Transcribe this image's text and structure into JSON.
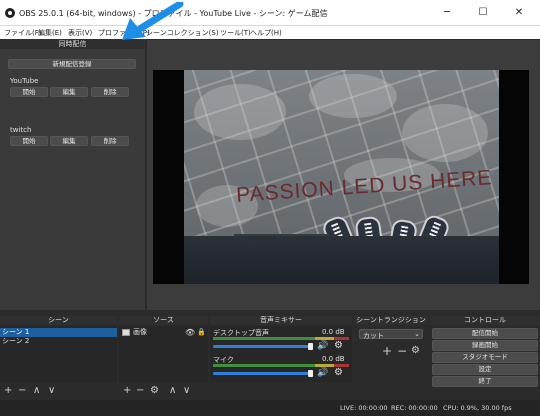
{
  "window": {
    "title": "OBS 25.0.1 (64-bit, windows) - プロファイル - YouTube Live - シーン: ゲーム配信",
    "min_icon": "minimize-icon",
    "max_icon": "maximize-icon",
    "close_icon": "close-icon"
  },
  "menubar": {
    "items": [
      "ファイル(F)",
      "編集(E)",
      "表示(V)",
      "プロファイル(P)",
      "シーンコレクション(S)",
      "ツール(T)",
      "ヘルプ(H)"
    ]
  },
  "multistream": {
    "title": "同時配信",
    "add_button": "新規配信登録",
    "destinations": [
      {
        "name": "YouTube",
        "buttons": [
          "開始",
          "編集",
          "削除"
        ]
      },
      {
        "name": "twitch",
        "buttons": [
          "開始",
          "編集",
          "削除"
        ]
      }
    ]
  },
  "preview": {
    "overlay_text": "PASSION LED US HERE"
  },
  "scenes": {
    "title": "シーン",
    "items": [
      "シーン 1",
      "シーン 2"
    ],
    "selected": 0
  },
  "sources": {
    "title": "ソース",
    "items": [
      "画像"
    ]
  },
  "mixer": {
    "title": "音声ミキサー",
    "channels": [
      {
        "name": "デスクトップ音声",
        "level": "0.0 dB",
        "volume": 0.73
      },
      {
        "name": "マイク",
        "level": "0.0 dB",
        "volume": 0.73
      }
    ]
  },
  "transitions": {
    "title": "シーントランジション",
    "selected": "カット"
  },
  "controls": {
    "title": "コントロール",
    "buttons": [
      "配信開始",
      "録画開始",
      "スタジオモード",
      "設定",
      "終了"
    ]
  },
  "status": {
    "live": "LIVE: 00:00:00",
    "rec": "REC: 00:00:00",
    "cpu": "CPU: 0.9%, 30.00 fps"
  },
  "colors": {
    "accent": "#1e8fe6",
    "selection": "#1e5f9e",
    "panel": "#3a3a3a"
  }
}
